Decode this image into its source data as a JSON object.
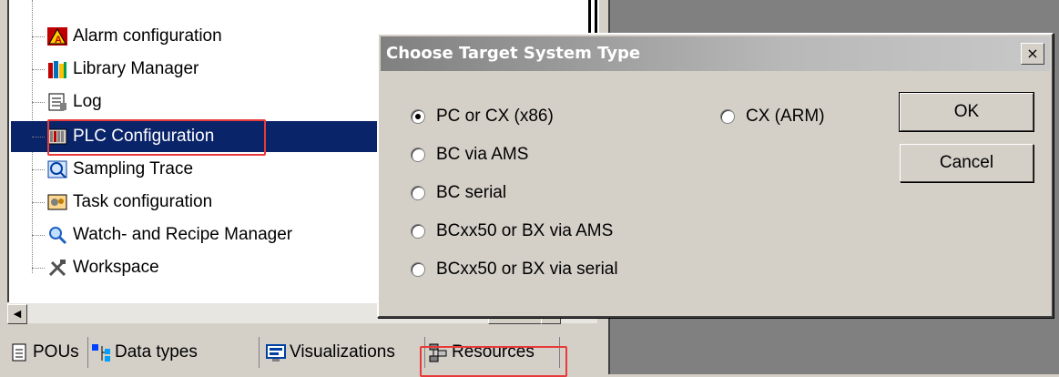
{
  "tree": {
    "items": [
      {
        "label": "Alarm configuration",
        "icon": "alarm-icon"
      },
      {
        "label": "Library Manager",
        "icon": "library-icon"
      },
      {
        "label": "Log",
        "icon": "log-icon"
      },
      {
        "label": "PLC Configuration",
        "icon": "plc-config-icon",
        "selected": true
      },
      {
        "label": "Sampling Trace",
        "icon": "sampling-trace-icon"
      },
      {
        "label": "Task configuration",
        "icon": "task-config-icon"
      },
      {
        "label": "Watch- and Recipe Manager",
        "icon": "magnifier-icon"
      },
      {
        "label": "Workspace",
        "icon": "tools-icon"
      }
    ]
  },
  "tabs": [
    {
      "label": "POUs",
      "icon": "document-icon"
    },
    {
      "label": "Data types",
      "icon": "data-types-icon"
    },
    {
      "label": "Visualizations",
      "icon": "visualization-icon"
    },
    {
      "label": "Resources",
      "icon": "resources-icon",
      "active": true
    }
  ],
  "dialog": {
    "title": "Choose Target System Type",
    "close": "×",
    "options": [
      {
        "label": "PC or CX (x86)",
        "checked": true
      },
      {
        "label": "BC via AMS",
        "checked": false
      },
      {
        "label": "BC serial",
        "checked": false
      },
      {
        "label": "BCxx50 or BX via AMS",
        "checked": false
      },
      {
        "label": "BCxx50 or BX via serial",
        "checked": false
      },
      {
        "label": "CX (ARM)",
        "checked": false
      }
    ],
    "ok": "OK",
    "cancel": "Cancel"
  },
  "colors": {
    "selection": "#0a246a",
    "highlight_box": "#e83a3a",
    "face": "#d4d0c8"
  }
}
